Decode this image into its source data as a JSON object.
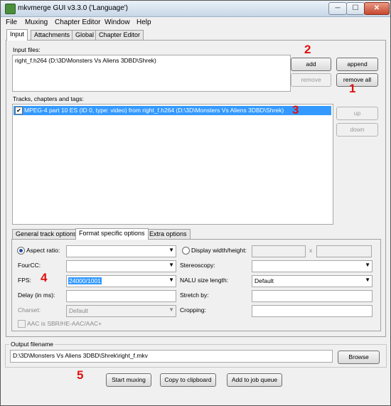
{
  "window": {
    "title": "mkvmerge GUI v3.3.0 ('Language')",
    "min": "─",
    "max": "☐",
    "close": "✕"
  },
  "menu": [
    "File",
    "Muxing",
    "Chapter Editor",
    "Window",
    "Help"
  ],
  "tabs": [
    "Input",
    "Attachments",
    "Global",
    "Chapter Editor"
  ],
  "input": {
    "label": "Input files:",
    "files": [
      "right_f.h264 (D:\\3D\\Monsters Vs Aliens 3DBD\\Shrek)"
    ],
    "buttons": {
      "add": "add",
      "append": "append",
      "remove": "remove",
      "remove_all": "remove all"
    }
  },
  "tracks": {
    "label": "Tracks, chapters and tags:",
    "items": [
      {
        "checked": true,
        "text": "MPEG-4 part 10 ES (ID 0, type: video) from right_f.h264 (D:\\3D\\Monsters Vs Aliens 3DBD\\Shrek)"
      }
    ],
    "buttons": {
      "up": "up",
      "down": "down"
    }
  },
  "subtabs": [
    "General track options",
    "Format specific options",
    "Extra options"
  ],
  "format": {
    "aspect_label": "Aspect ratio:",
    "display_label": "Display width/height:",
    "x_sep": "x",
    "fourcc_label": "FourCC:",
    "stereo_label": "Stereoscopy:",
    "fps_label": "FPS:",
    "fps_value": "24000/1001",
    "nalu_label": "NALU size length:",
    "nalu_value": "Default",
    "delay_label": "Delay (in ms):",
    "stretch_label": "Stretch by:",
    "charset_label": "Charset:",
    "charset_value": "Default",
    "cropping_label": "Cropping:",
    "aac_label": "AAC is SBR/HE-AAC/AAC+"
  },
  "output": {
    "label": "Output filename",
    "value": "D:\\3D\\Monsters Vs Aliens 3DBD\\Shrek\\right_f.mkv",
    "browse": "Browse"
  },
  "actions": {
    "start": "Start muxing",
    "copy": "Copy to clipboard",
    "queue": "Add to job queue"
  },
  "annotations": [
    "2",
    "1",
    "3",
    "4",
    "5"
  ],
  "colors": {
    "selection": "#3399ff",
    "annotation": "#e01010"
  },
  "icons": {
    "check": "✔",
    "dropdown": "▼"
  }
}
